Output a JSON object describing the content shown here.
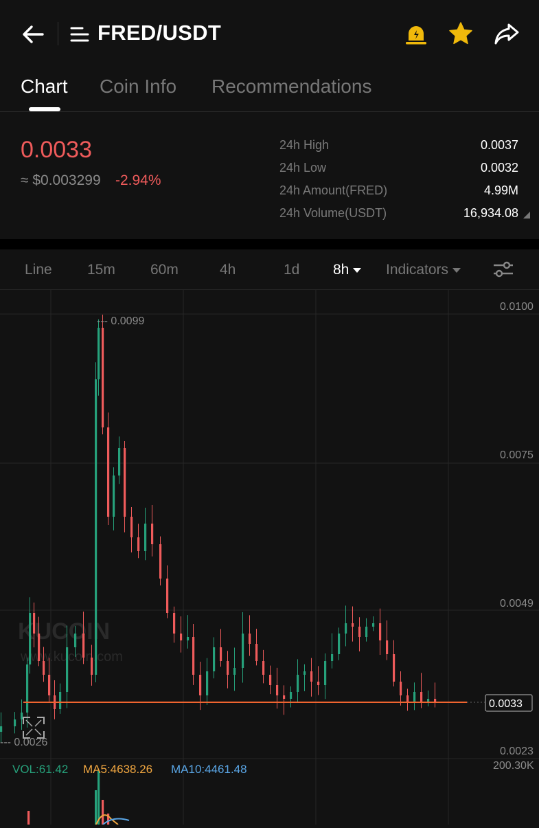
{
  "header": {
    "title": "FRED/USDT",
    "icons": [
      "back-arrow-icon",
      "menu-icon",
      "alarm-bell-icon",
      "star-icon",
      "share-icon"
    ],
    "accent_color": "#f0b90b"
  },
  "tabs": [
    {
      "label": "Chart",
      "active": true
    },
    {
      "label": "Coin Info",
      "active": false
    },
    {
      "label": "Recommendations",
      "active": false
    }
  ],
  "ticker": {
    "price": "0.0033",
    "usd_price": "≈ $0.003299",
    "change": "-2.94%",
    "price_color": "#ef5b5b"
  },
  "stats": [
    {
      "label": "24h High",
      "value": "0.0037"
    },
    {
      "label": "24h Low",
      "value": "0.0032"
    },
    {
      "label": "24h Amount(FRED)",
      "value": "4.99M"
    },
    {
      "label": "24h Volume(USDT)",
      "value": "16,934.08"
    }
  ],
  "timeframes": {
    "items": [
      "Line",
      "15m",
      "60m",
      "4h",
      "1d"
    ],
    "selected": "8h",
    "indicators_label": "Indicators"
  },
  "chart": {
    "y_ticks": [
      "0.0100",
      "0.0075",
      "0.0049",
      "0.0023"
    ],
    "high_label": "--- 0.0099",
    "low_label": "--- 0.0026",
    "current_price_tag": "0.0033",
    "watermark": "KUCOIN",
    "watermark_url": "www.kucoin.com",
    "up_color": "#26a17b",
    "down_color": "#ef5b5b",
    "last_price_line_color": "#f0642f"
  },
  "volume": {
    "vol_label": "VOL:61.42",
    "ma5_label": "MA5:4638.26",
    "ma10_label": "MA10:4461.48",
    "max_label": "200.30K",
    "vol_color": "#26a17b",
    "ma5_color": "#f0a640",
    "ma10_color": "#5aa6e6"
  }
}
